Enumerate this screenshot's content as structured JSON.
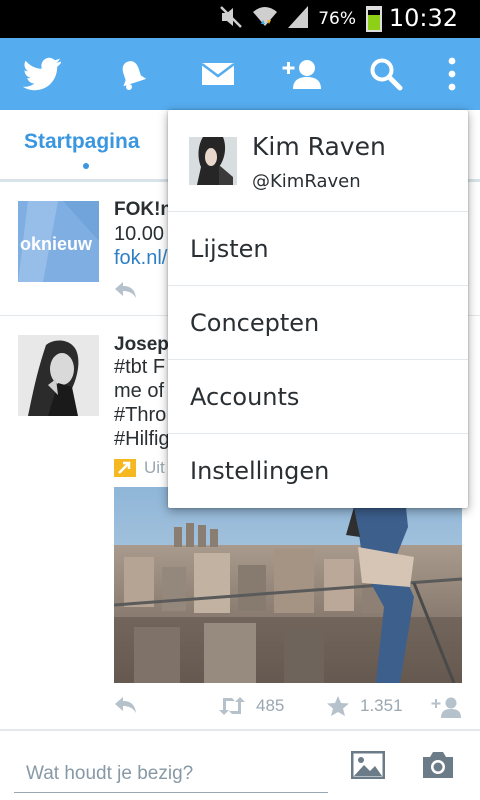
{
  "status_bar": {
    "battery_percent": "76%",
    "battery_level": 0.76,
    "time": "10:32",
    "icons": [
      "mute-icon",
      "wifi-icon",
      "signal-icon",
      "battery-icon"
    ]
  },
  "action_bar": {
    "color": "#55acee",
    "icons": [
      "twitter-bird-icon",
      "bell-icon",
      "envelope-icon",
      "add-user-icon",
      "search-icon",
      "overflow-menu-icon"
    ]
  },
  "tabs": {
    "home_label": "Startpagina",
    "accent": "#3a97df"
  },
  "feed": {
    "tweets": [
      {
        "name": "FOK!n",
        "lines": [
          "10.00"
        ],
        "link": "fok.nl/",
        "avatar_text": "oknieuw"
      },
      {
        "name": "Josep",
        "lines": [
          "#tbt F",
          "me of",
          "#Thro",
          "#Hilfig"
        ],
        "media_label": "Uit",
        "retweets": "485",
        "favorites": "1.351"
      }
    ]
  },
  "compose": {
    "placeholder": "Wat houdt je bezig?"
  },
  "overflow_menu": {
    "profile": {
      "name": "Kim Raven",
      "handle": "@KimRaven"
    },
    "items": [
      "Lijsten",
      "Concepten",
      "Accounts",
      "Instellingen"
    ]
  }
}
